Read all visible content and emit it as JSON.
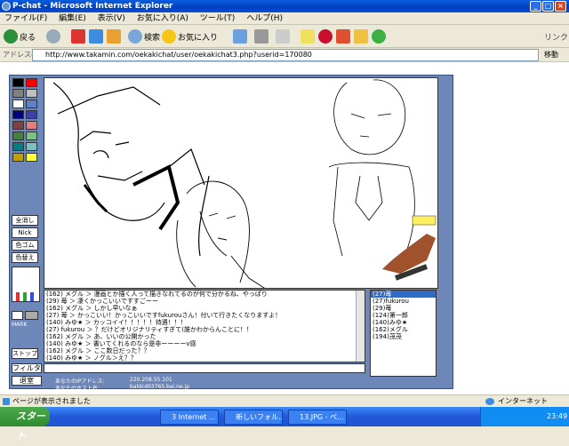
{
  "window": {
    "title": "P-chat - Microsoft Internet Explorer"
  },
  "menu": [
    "ファイル(F)",
    "編集(E)",
    "表示(V)",
    "お気に入り(A)",
    "ツール(T)",
    "ヘルプ(H)"
  ],
  "toolbar": {
    "back": "戻る",
    "search": "検索",
    "favorites": "お気に入り",
    "links": "リンク"
  },
  "address": {
    "label": "アドレス(D)",
    "url": "http://www.takamin.com/oekakichat/user/oekakichat3.php?userid=170080",
    "go": "移動"
  },
  "oekaki": {
    "tools": [
      "全消し",
      "Nick",
      "色ゴム",
      "色替え"
    ],
    "sliders": "MARK",
    "stop": "ストップ",
    "filter": "フィルタ",
    "exit": "退室",
    "ip_label": "あなたのIPアドレス:",
    "ip_value": "220.208.55.101",
    "host_label": "あなたのホスト名:",
    "host_value": "baldcd03765.bai.ne.jp"
  },
  "chat": [
    "(162) メグル ＞ 漫画とか描く人って描きなれてるのが何で分かるね、やっぱり",
    "(29) 苺 ＞ 凄くかっこいいですすごーー",
    "(162) メグル ＞ しかし早いなぁ",
    "(27) 苺 ＞ かっこいい！かっこいいですfukurouさん！付いて行きたくなりますよ！",
    "(140) みゆ★ ＞ カッコイイ！！！！！待遇！！！",
    "(27) fukurou ＞ ？だけどオリジナリティすぎて(誰かわからんことに！！",
    "(162) メグル ＞ あ、いいの公開かった",
    "(140) みゆ★ ＞ 書いてくれるのなら是非ーーーーv感",
    "(162) メグル ＞ ここ数日だった？？",
    "(140) みゆ★ ＞ ノグル＞え？？"
  ],
  "users": [
    "(27)苺",
    "(27)fukurou",
    "(29)苺",
    "(124)第一郎",
    "(140)みゆ★",
    "(162)メグル",
    "(194)茂茂"
  ],
  "status": {
    "text": "ページが表示されました",
    "zone": "インターネット"
  },
  "taskbar": {
    "start": "スタート",
    "tasks": [
      "3 Internet ...",
      "新しいフォル...",
      "13.JPG - ペ..."
    ],
    "time": "23:49"
  },
  "colors": {
    "accent": "#316ac5",
    "app_bg": "#6d87b8",
    "palette": [
      "#000000",
      "#ff0000",
      "#808080",
      "#c0c0c0",
      "#ffffff",
      "#6080c0",
      "#000080",
      "#4040a0",
      "#804040",
      "#e08080",
      "#408040",
      "#80c080",
      "#008080",
      "#80c0c0",
      "#c0a000",
      "#ffff40"
    ]
  }
}
